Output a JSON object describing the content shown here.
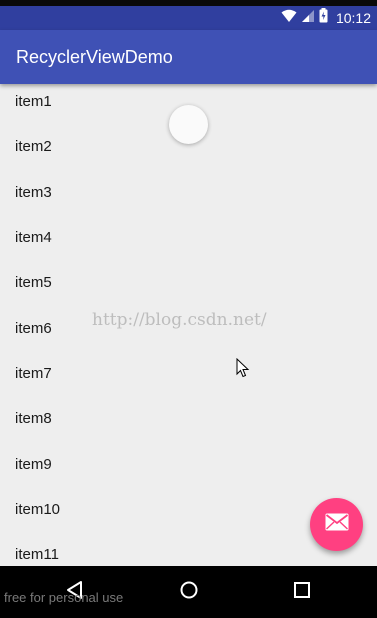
{
  "status_bar": {
    "time": "10:12",
    "icons": [
      "wifi-icon",
      "signal-icon",
      "battery-charging-icon"
    ]
  },
  "app_bar": {
    "title": "RecyclerViewDemo"
  },
  "list": {
    "items": [
      {
        "label": "item1"
      },
      {
        "label": "item2"
      },
      {
        "label": "item3"
      },
      {
        "label": "item4"
      },
      {
        "label": "item5"
      },
      {
        "label": "item6"
      },
      {
        "label": "item7"
      },
      {
        "label": "item8"
      },
      {
        "label": "item9"
      },
      {
        "label": "item10"
      },
      {
        "label": "item11"
      }
    ]
  },
  "watermark": "http://blog.csdn.net/",
  "fab": {
    "icon": "mail-icon"
  },
  "nav_bar": {
    "buttons": [
      "back-icon",
      "home-icon",
      "recents-icon"
    ],
    "footer_text": "free for personal use"
  },
  "colors": {
    "primary": "#3f51b5",
    "primary_dark": "#303f9f",
    "accent": "#ff4081",
    "background": "#eeeeee"
  }
}
